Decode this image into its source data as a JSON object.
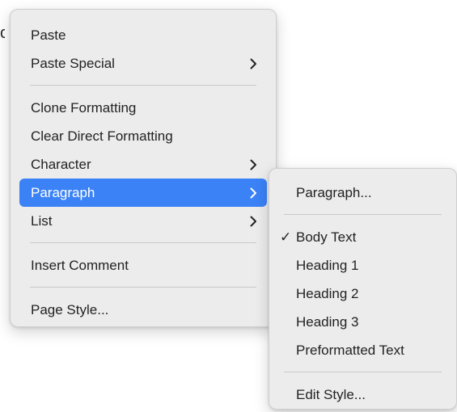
{
  "context_menu": {
    "items": [
      {
        "label": "Paste",
        "submenu": false
      },
      {
        "label": "Paste Special",
        "submenu": true
      },
      {
        "label": "Clone Formatting",
        "submenu": false
      },
      {
        "label": "Clear Direct Formatting",
        "submenu": false
      },
      {
        "label": "Character",
        "submenu": true
      },
      {
        "label": "Paragraph",
        "submenu": true,
        "highlighted": true
      },
      {
        "label": "List",
        "submenu": true
      },
      {
        "label": "Insert Comment",
        "submenu": false
      },
      {
        "label": "Page Style...",
        "submenu": false
      }
    ]
  },
  "paragraph_submenu": {
    "items": [
      {
        "label": "Paragraph...",
        "checked": false
      },
      {
        "label": "Body Text",
        "checked": true
      },
      {
        "label": "Heading 1",
        "checked": false
      },
      {
        "label": "Heading 2",
        "checked": false
      },
      {
        "label": "Heading 3",
        "checked": false
      },
      {
        "label": "Preformatted Text",
        "checked": false
      },
      {
        "label": "Edit Style...",
        "checked": false
      }
    ],
    "check_mark": "✓"
  },
  "colors": {
    "menu_background": "#ececec",
    "highlight": "#3b82f6",
    "separator": "#c9c9c9",
    "text": "#222222"
  },
  "icons": {
    "submenu_indicator": "chevron-right-icon",
    "checked_indicator": "checkmark-icon"
  }
}
